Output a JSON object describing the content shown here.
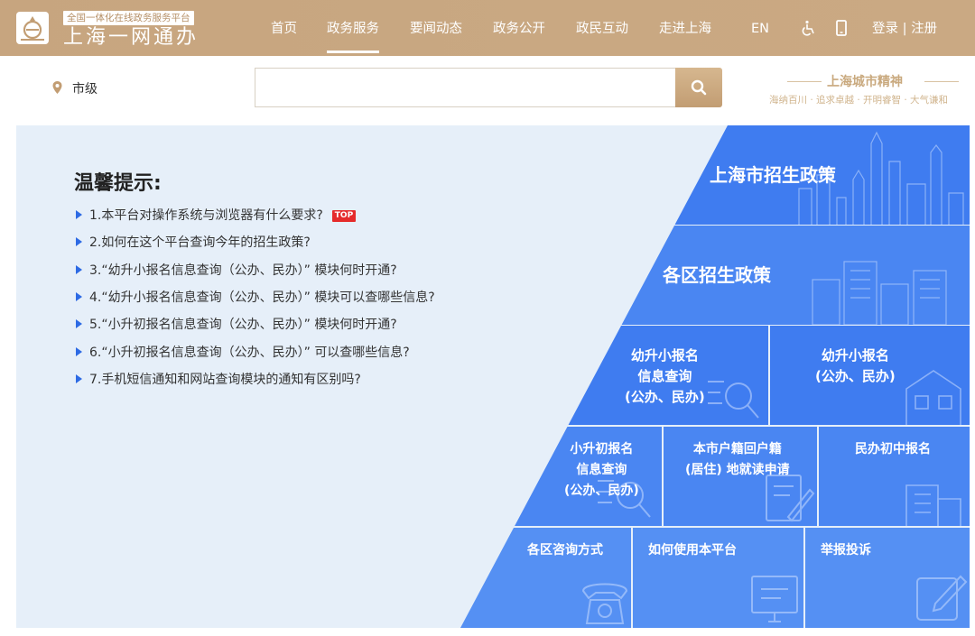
{
  "header": {
    "logo_sub": "全国一体化在线政务服务平台",
    "logo_main": "上海一网通办",
    "nav": [
      {
        "label": "首页",
        "active": false
      },
      {
        "label": "政务服务",
        "active": true
      },
      {
        "label": "要闻动态",
        "active": false
      },
      {
        "label": "政务公开",
        "active": false
      },
      {
        "label": "政民互动",
        "active": false
      },
      {
        "label": "走进上海",
        "active": false
      },
      {
        "label": "EN",
        "active": false
      }
    ],
    "accessibility_icon": "wheelchair-icon",
    "mobile_icon": "mobile-phone-icon",
    "login": "登录 | 注册",
    "bg_color": "#c9a882"
  },
  "search": {
    "location": "市级",
    "value": "",
    "placeholder": "",
    "button_icon": "search-icon"
  },
  "spirit": {
    "title": "上海城市精神",
    "subtitle": "海纳百川 · 追求卓越 · 开明睿智 · 大气谦和"
  },
  "tips": {
    "title": "温馨提示:",
    "items": [
      "1.本平台对操作系统与浏览器有什么要求?",
      "2.如何在这个平台查询今年的招生政策?",
      "3.“幼升小报名信息查询（公办、民办）” 模块何时开通?",
      "4.“幼升小报名信息查询（公办、民办）” 模块可以查哪些信息?",
      "5.“小升初报名信息查询（公办、民办）” 模块何时开通?",
      "6.“小升初报名信息查询（公办、民办）” 可以查哪些信息?",
      "7.手机短信通知和网站查询模块的通知有区别吗?"
    ],
    "top_badge": "TOP"
  },
  "tiles": {
    "city_policy": "上海市招生政策",
    "district_policy": "各区招生政策",
    "k1_query": [
      "幼升小报名",
      "信息查询",
      "(公办、民办)"
    ],
    "k1_apply": [
      "幼升小报名",
      "(公办、民办)"
    ],
    "p6_query": [
      "小升初报名",
      "信息查询",
      "(公办、民办)"
    ],
    "hukou": [
      "本市户籍回户籍",
      "(居住) 地就读申请"
    ],
    "private_middle": "民办初中报名",
    "district_contact": "各区咨询方式",
    "how_to_use": "如何使用本平台",
    "report": "举报投诉"
  },
  "colors": {
    "accent": "#c9a882",
    "tile_blue": "#3f7cf0",
    "panel_bg": "#e6eff9",
    "bullet": "#2d6ae4",
    "top_badge": "#e52b2b"
  }
}
